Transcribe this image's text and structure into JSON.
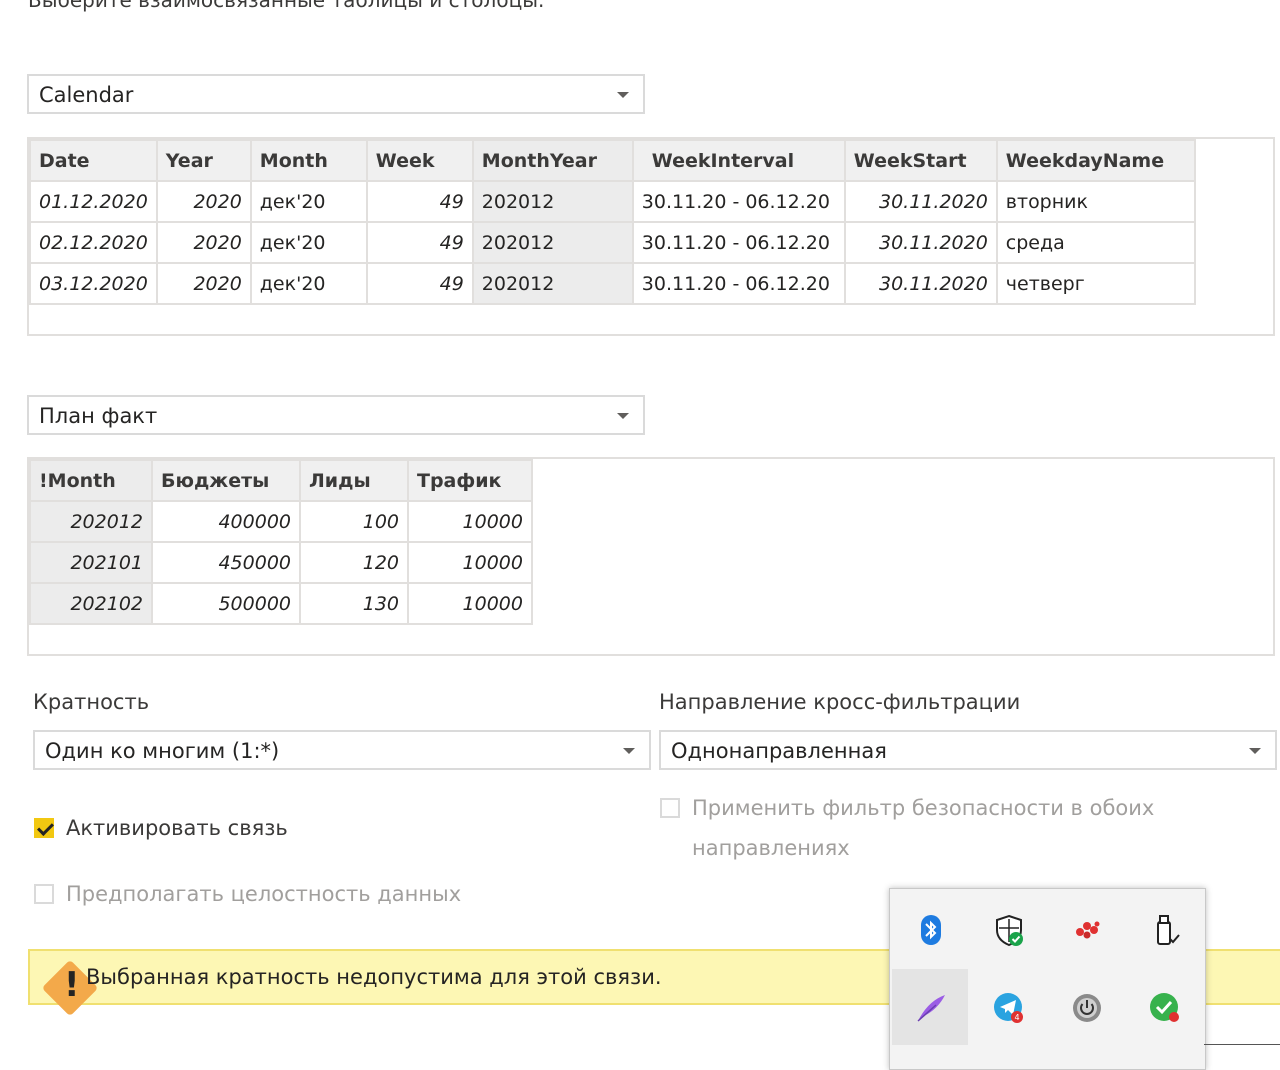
{
  "instruction": "Выберите взаимосвязанные таблицы и столбцы.",
  "table1": {
    "selected": "Calendar",
    "columns": [
      "Date",
      "Year",
      "Month",
      "Week",
      "MonthYear",
      "WeekInterval",
      "WeekStart",
      "WeekdayName"
    ],
    "rows": [
      [
        "01.12.2020",
        "2020",
        "дек'20",
        "49",
        "202012",
        "30.11.20 - 06.12.20",
        "30.11.2020",
        "вторник"
      ],
      [
        "02.12.2020",
        "2020",
        "дек'20",
        "49",
        "202012",
        "30.11.20 - 06.12.20",
        "30.11.2020",
        "среда"
      ],
      [
        "03.12.2020",
        "2020",
        "дек'20",
        "49",
        "202012",
        "30.11.20 - 06.12.20",
        "30.11.2020",
        "четверг"
      ]
    ]
  },
  "table2": {
    "selected": "План факт",
    "columns": [
      "!Month",
      "Бюджеты",
      "Лиды",
      "Трафик"
    ],
    "rows": [
      [
        "202012",
        "400000",
        "100",
        "10000"
      ],
      [
        "202101",
        "450000",
        "120",
        "10000"
      ],
      [
        "202102",
        "500000",
        "130",
        "10000"
      ]
    ]
  },
  "cardinality": {
    "label": "Кратность",
    "value": "Один ко многим (1:*)"
  },
  "crossfilter": {
    "label": "Направление кросс-фильтрации",
    "value": "Однонаправленная"
  },
  "options": {
    "activate": "Активировать связь",
    "integrity": "Предполагать целостность данных",
    "security_line1": "Применить фильтр безопасности в обоих",
    "security_line2": "направлениях"
  },
  "warning": "Выбранная кратность недопустима для этой связи.",
  "tray_icons": [
    "bluetooth-icon",
    "windows-security-icon",
    "app-dots-icon",
    "usb-eject-icon",
    "feather-pen-icon",
    "telegram-icon",
    "power-icon",
    "security-check-icon"
  ],
  "colors": {
    "accent_yellow": "#f2c811",
    "warning_bg": "#fdf7b4",
    "warning_icon": "#f3a94a"
  }
}
